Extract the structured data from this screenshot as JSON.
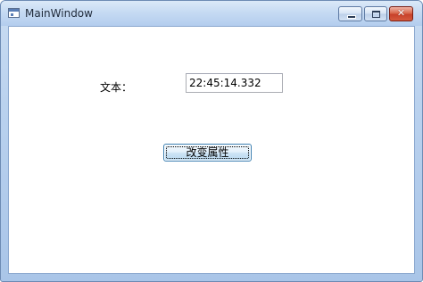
{
  "window": {
    "title": "MainWindow"
  },
  "icons": {
    "app": "app-window-icon",
    "minimize": "minimize-icon",
    "maximize": "maximize-icon",
    "close": "close-icon"
  },
  "colors": {
    "frame": "#b9d1ee",
    "close_button": "#c8412a",
    "button_border": "#3c7fb1",
    "client_background": "#ffffff"
  },
  "form": {
    "label": "文本：",
    "text_value": "22:45:14.332",
    "button_label": "改变属性"
  }
}
